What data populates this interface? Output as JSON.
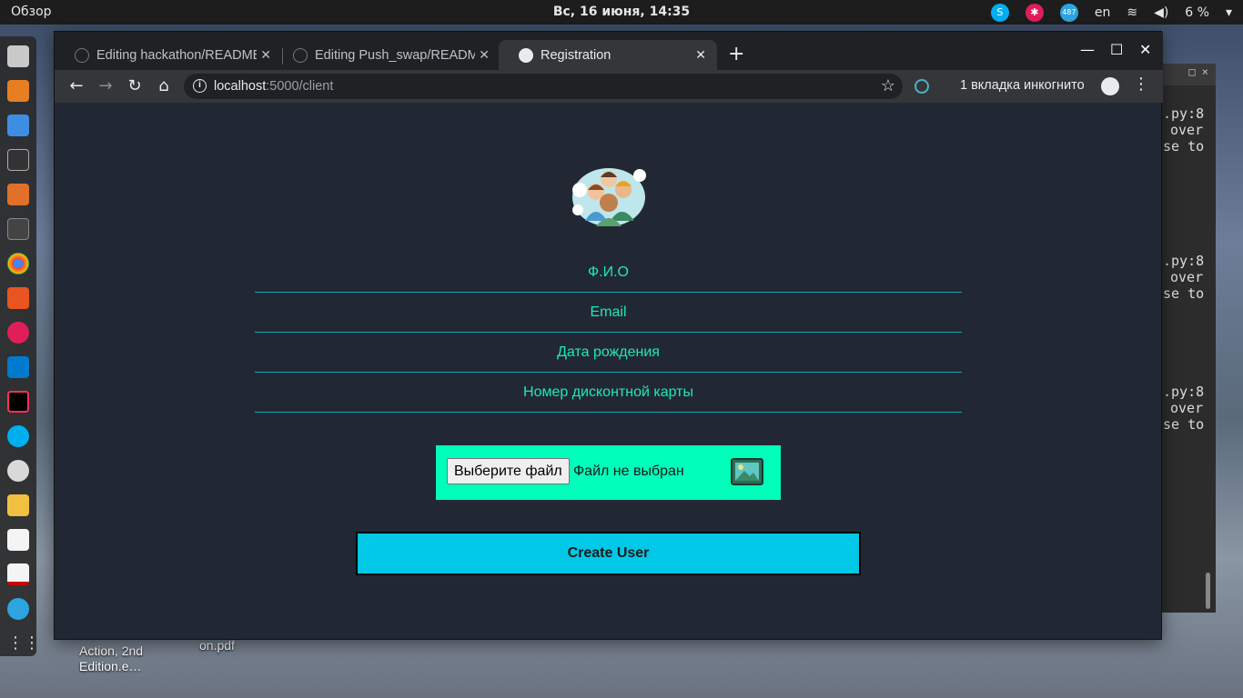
{
  "topbar": {
    "overview": "Обзор",
    "clock": "Вс, 16 июня, 14:35",
    "lang": "en",
    "battery": "6 %",
    "telegram_badge": "487"
  },
  "browser": {
    "tabs": [
      {
        "label": "Editing hackathon/README.md",
        "icon": "github-icon"
      },
      {
        "label": "Editing Push_swap/README.md",
        "icon": "github-icon"
      },
      {
        "label": "Registration",
        "icon": "globe-icon"
      }
    ],
    "url_host": "localhost",
    "url_rest": ":5000/client",
    "incognito_label": "1 вкладка инкогнито"
  },
  "form": {
    "fields": [
      {
        "placeholder": "Ф.И.О"
      },
      {
        "placeholder": "Email"
      },
      {
        "placeholder": "Дата рождения"
      },
      {
        "placeholder": "Номер дисконтной карты"
      }
    ],
    "file_button": "Выберите файл",
    "file_status": "Файл не выбран",
    "submit": "Create User"
  },
  "terminal": {
    "lines": [
      ".py:8",
      "over",
      "se to"
    ]
  },
  "desktop": {
    "file1": "Action, 2nd Edition.e…",
    "file2": "on.pdf"
  },
  "colors": {
    "page_bg": "#222833",
    "accent_text": "#1de9b6",
    "underline": "#16a2b8",
    "file_box": "#00ffbb",
    "button": "#00c8e6"
  }
}
